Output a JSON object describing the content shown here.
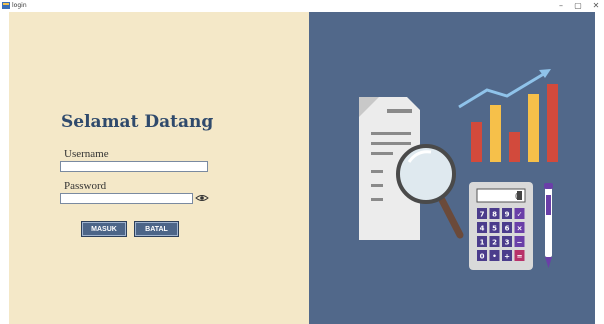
{
  "window": {
    "title": "login",
    "minimize": "–",
    "maximize": "▢",
    "close": "✕"
  },
  "form": {
    "heading": "Selamat Datang",
    "username_label": "Username",
    "username_value": "",
    "password_label": "Password",
    "password_value": "",
    "login_button": "MASUK",
    "cancel_button": "BATAL"
  },
  "calculator": {
    "display": "0",
    "keys": [
      "7",
      "8",
      "9",
      "✓",
      "4",
      "5",
      "6",
      "×",
      "1",
      "2",
      "3",
      "−",
      "0",
      "•",
      "+",
      "="
    ]
  },
  "icons": {
    "app": "app-icon",
    "eye": "eye-icon",
    "document": "document-icon",
    "magnifier": "magnifier-icon",
    "chart": "bar-chart-icon",
    "calculator": "calculator-icon",
    "pen": "pen-icon"
  },
  "colors": {
    "left_bg": "#f4e8c8",
    "right_bg": "#51688a",
    "heading": "#2f4a6c",
    "button_bg": "#4c6588"
  }
}
